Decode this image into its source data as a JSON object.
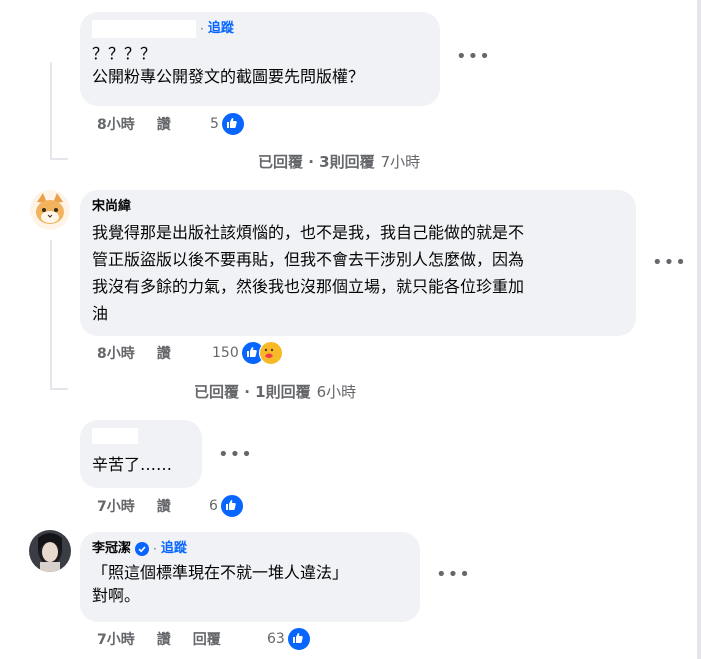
{
  "comments": [
    {
      "author": "",
      "follow_label": "追蹤",
      "text_lines": [
        "？？？？",
        "公開粉專公開發文的截圖要先問版權？"
      ],
      "time": "8小時",
      "like_label": "讚",
      "reaction_count": "5",
      "replies": {
        "label": "已回覆 · 3則回覆",
        "time": "7小時"
      }
    },
    {
      "author": "宋尚緯",
      "text_lines": [
        "我覺得那是出版社該煩惱的，也不是我，我自己能做的就是不",
        "管正版盜版以後不要再貼，但我不會去干涉別人怎麼做，因為",
        "我沒有多餘的力氣，然後我也沒那個立場，就只能各位珍重加",
        "油"
      ],
      "time": "8小時",
      "like_label": "讚",
      "reaction_count": "150",
      "replies": {
        "label": "已回覆 · 1則回覆",
        "time": "6小時"
      }
    },
    {
      "author": "",
      "text_lines": [
        "辛苦了……"
      ],
      "time": "7小時",
      "like_label": "讚",
      "reaction_count": "6"
    },
    {
      "author": "李冠潔",
      "follow_label": "追蹤",
      "text_lines": [
        "「照這個標準現在不就一堆人違法」",
        "對啊。"
      ],
      "time": "7小時",
      "like_label": "讚",
      "reply_label": "回覆",
      "reaction_count": "63"
    }
  ],
  "icons": {
    "like": "like-icon",
    "care": "care-icon",
    "more": "more-options-icon",
    "verified": "verified-badge-icon"
  },
  "colors": {
    "accent": "#0866ff",
    "bubble": "#f0f2f5",
    "meta": "#65676b"
  }
}
